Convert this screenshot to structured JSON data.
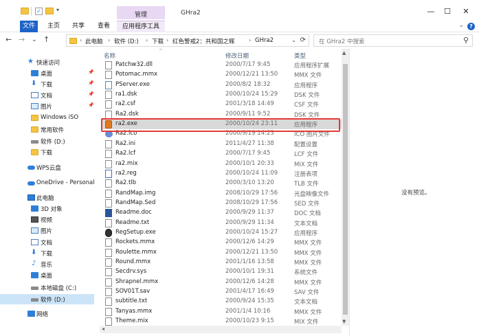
{
  "window": {
    "title": "GHra2",
    "context_tab_group": "管理",
    "controls": {
      "minimize": "—",
      "maximize": "☐",
      "close": "✕"
    }
  },
  "quick_access_toolbar": {
    "check": "✓",
    "more": "▾"
  },
  "ribbon": {
    "tabs": [
      "文件",
      "主页",
      "共享",
      "查看",
      "应用程序工具"
    ],
    "help": "?"
  },
  "address_bar": {
    "back": "←",
    "forward": "→",
    "recent": "⌄",
    "up": "↑",
    "breadcrumbs": [
      "此电脑",
      "软件 (D:)",
      "下载",
      "红色警戒2：共和国之辉",
      "GHra2"
    ],
    "separator": "›",
    "dropdown": "⌄",
    "refresh": "⟳"
  },
  "search": {
    "placeholder": "在 GHra2 中搜索",
    "icon": "⚲"
  },
  "nav_pane": {
    "items": [
      {
        "label": "快速访问",
        "icon": "star-icon"
      },
      {
        "label": "桌面",
        "icon": "desktop-icon",
        "pinned": true
      },
      {
        "label": "下载",
        "icon": "download-icon",
        "pinned": true
      },
      {
        "label": "文档",
        "icon": "document-icon",
        "pinned": true
      },
      {
        "label": "图片",
        "icon": "picture-icon",
        "pinned": true
      },
      {
        "label": "Windows iSO",
        "icon": "folder-icon"
      },
      {
        "label": "常用软件",
        "icon": "folder-icon"
      },
      {
        "label": "软件 (D:)",
        "icon": "drive-icon"
      },
      {
        "label": "下载",
        "icon": "folder-icon"
      },
      {
        "label": "WPS云盘",
        "icon": "cloud-icon"
      },
      {
        "label": "OneDrive - Personal",
        "icon": "cloud-icon"
      },
      {
        "label": "此电脑",
        "icon": "computer-icon"
      },
      {
        "label": "3D 对象",
        "icon": "3d-objects-icon"
      },
      {
        "label": "视频",
        "icon": "video-icon"
      },
      {
        "label": "图片",
        "icon": "picture-icon"
      },
      {
        "label": "文档",
        "icon": "document-icon"
      },
      {
        "label": "下载",
        "icon": "download-icon"
      },
      {
        "label": "音乐",
        "icon": "music-icon"
      },
      {
        "label": "桌面",
        "icon": "desktop-icon"
      },
      {
        "label": "本地磁盘 (C:)",
        "icon": "drive-icon"
      },
      {
        "label": "软件 (D:)",
        "icon": "drive-icon",
        "selected": true
      },
      {
        "label": "网络",
        "icon": "network-icon"
      }
    ],
    "pin_glyph": "📌"
  },
  "file_list": {
    "columns": {
      "name": "名称",
      "date": "修改日期",
      "type": "类型"
    },
    "sort_indicator": "^",
    "files": [
      {
        "name": "Patchw32.dll",
        "date": "2000/7/17 9:45",
        "type": "应用程序扩展",
        "icon": "dll"
      },
      {
        "name": "Potomac.mmx",
        "date": "2000/12/21 13:50",
        "type": "MMX 文件",
        "icon": "file"
      },
      {
        "name": "PServer.exe",
        "date": "2000/8/2 18:32",
        "type": "应用程序",
        "icon": "exe"
      },
      {
        "name": "ra1.dsk",
        "date": "2000/10/24 15:29",
        "type": "DSK 文件",
        "icon": "file"
      },
      {
        "name": "ra2.csf",
        "date": "2001/3/18 14:49",
        "type": "CSF 文件",
        "icon": "file"
      },
      {
        "name": "Ra2.dsk",
        "date": "2000/9/11 9:52",
        "type": "DSK 文件",
        "icon": "file"
      },
      {
        "name": "ra2.exe",
        "date": "2000/10/24 23:11",
        "type": "应用程序",
        "icon": "ra2",
        "selected": true
      },
      {
        "name": "Ra2.ico",
        "date": "2000/9/19 14:23",
        "type": "ICO 图片文件",
        "icon": "ico"
      },
      {
        "name": "Ra2.ini",
        "date": "2011/4/27 11:38",
        "type": "配置设置",
        "icon": "file"
      },
      {
        "name": "Ra2.lcf",
        "date": "2000/7/17 9:45",
        "type": "LCF 文件",
        "icon": "file"
      },
      {
        "name": "ra2.mix",
        "date": "2000/10/1 20:33",
        "type": "MIX 文件",
        "icon": "file"
      },
      {
        "name": "ra2.reg",
        "date": "2000/10/24 11:09",
        "type": "注册表项",
        "icon": "reg"
      },
      {
        "name": "Ra2.tlb",
        "date": "2000/3/10 13:20",
        "type": "TLB 文件",
        "icon": "file"
      },
      {
        "name": "RandMap.img",
        "date": "2008/10/29 17:56",
        "type": "光盘映像文件",
        "icon": "file"
      },
      {
        "name": "RandMap.Sed",
        "date": "2008/10/29 17:56",
        "type": "SED 文件",
        "icon": "file"
      },
      {
        "name": "Readme.doc",
        "date": "2000/9/29 11:37",
        "type": "DOC 文档",
        "icon": "word"
      },
      {
        "name": "Readme.txt",
        "date": "2000/9/29 11:34",
        "type": "文本文档",
        "icon": "file"
      },
      {
        "name": "RegSetup.exe",
        "date": "2000/10/24 15:27",
        "type": "应用程序",
        "icon": "setup"
      },
      {
        "name": "Rockets.mmx",
        "date": "2000/12/6 14:29",
        "type": "MMX 文件",
        "icon": "file"
      },
      {
        "name": "Roulette.mmx",
        "date": "2000/12/21 13:50",
        "type": "MMX 文件",
        "icon": "file"
      },
      {
        "name": "Round.mmx",
        "date": "2001/1/16 13:58",
        "type": "MMX 文件",
        "icon": "file"
      },
      {
        "name": "Secdrv.sys",
        "date": "2000/10/1 19:31",
        "type": "系统文件",
        "icon": "file"
      },
      {
        "name": "Shrapnel.mmx",
        "date": "2000/12/6 14:28",
        "type": "MMX 文件",
        "icon": "file"
      },
      {
        "name": "SOV01T.sav",
        "date": "2001/4/17 16:49",
        "type": "SAV 文件",
        "icon": "file"
      },
      {
        "name": "subtitle.txt",
        "date": "2000/9/24 15:35",
        "type": "文本文档",
        "icon": "file"
      },
      {
        "name": "Tanyas.mmx",
        "date": "2001/1/4 10:16",
        "type": "MMX 文件",
        "icon": "file"
      },
      {
        "name": "Theme.mix",
        "date": "2000/10/23 9:15",
        "type": "MIX 文件",
        "icon": "file"
      }
    ]
  },
  "scrollbars": {
    "up": "▲",
    "down": "▼",
    "left": "◂"
  },
  "preview_pane": {
    "text": "没有预览。"
  },
  "colors": {
    "accent": "#1e64c8",
    "selection": "#d9d9d9",
    "highlight_outline": "#e53935",
    "context_tab": "#e8d8f3"
  }
}
